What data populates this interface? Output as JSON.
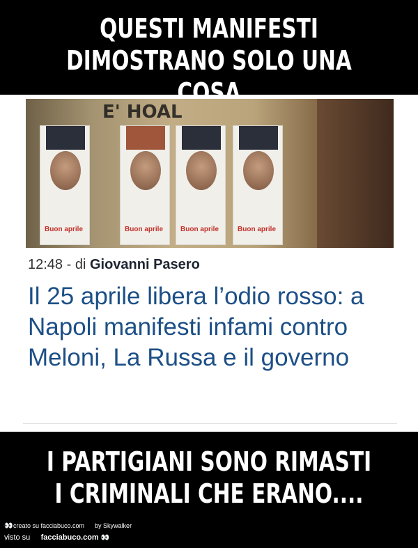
{
  "meme": {
    "top_caption": "QUESTI MANIFESTI DIMOSTRANO SOLO UNA COSA",
    "bottom_caption": "I PARTIGIANI SONO RIMASTI I CRIMINALI CHE ERANO...."
  },
  "article": {
    "time": "12:48",
    "by": " - di ",
    "author": "Giovanni Pasero",
    "headline": "Il 25 aprile libera l’odio rosso: a Napoli manifesti infami contro Meloni, La Russa e il governo"
  },
  "photo": {
    "graffiti": "E' HOAL",
    "poster_label": "Buon aprile"
  },
  "footer": {
    "created": "creato su facciabuco.com",
    "by": "by Skywalker",
    "seen": "visto su",
    "site": "facciabuco.com"
  }
}
